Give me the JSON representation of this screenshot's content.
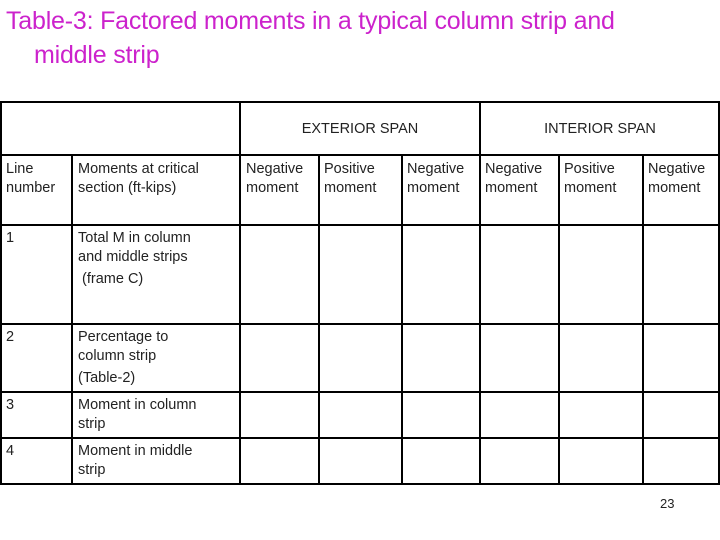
{
  "title": {
    "line1": "Table-3: Factored moments in a typical column strip and",
    "line2": "middle strip",
    "color": "#cc22cc"
  },
  "table": {
    "span_headers": [
      "EXTERIOR SPAN",
      "INTERIOR SPAN"
    ],
    "column_headers": {
      "line_number": [
        "Line",
        "number"
      ],
      "moments": [
        "Moments at critical",
        "section (ft-kips)"
      ],
      "moment_cols": [
        [
          "Negative",
          "moment"
        ],
        [
          "Positive",
          "moment"
        ],
        [
          "Negative",
          "moment"
        ],
        [
          "Negative",
          "moment"
        ],
        [
          "Positive",
          "moment"
        ],
        [
          "Negative",
          "moment"
        ]
      ]
    },
    "rows": [
      {
        "number": "1",
        "label": [
          "Total M in column",
          "and middle strips",
          " (frame C)"
        ],
        "values": [
          "",
          "",
          "",
          "",
          "",
          ""
        ]
      },
      {
        "number": "2",
        "label": [
          "Percentage to",
          "column strip",
          "(Table-2)"
        ],
        "values": [
          "",
          "",
          "",
          "",
          "",
          ""
        ]
      },
      {
        "number": "3",
        "label": [
          "Moment in column",
          "strip"
        ],
        "values": [
          "",
          "",
          "",
          "",
          "",
          ""
        ]
      },
      {
        "number": "4",
        "label": [
          "Moment in middle",
          "strip"
        ],
        "values": [
          "",
          "",
          "",
          "",
          "",
          ""
        ]
      }
    ]
  },
  "page_number": "23"
}
